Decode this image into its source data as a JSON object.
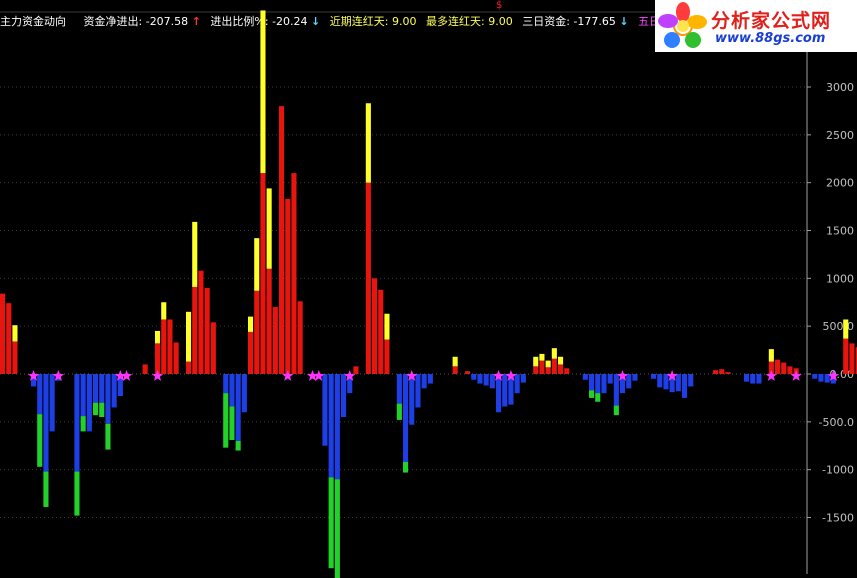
{
  "header": {
    "title": "主力资金动向",
    "items": [
      {
        "label": "资金净进出:",
        "value": "-207.58",
        "arrow": "↑"
      },
      {
        "label": "进出比例%:",
        "value": "-20.24",
        "arrow": "↓"
      },
      {
        "label": "近期连红天:",
        "value": "9.00"
      },
      {
        "label": "最多连红天:",
        "value": "9.00"
      },
      {
        "label": "三日资金:",
        "value": "-177.65",
        "arrow": "↓"
      },
      {
        "label": "五日"
      }
    ],
    "top_marker": "$"
  },
  "logo": {
    "text": "分析家公式网",
    "url": "www.88gs.com"
  },
  "colors": {
    "background": "#000000",
    "positive_bar": "#e8140e",
    "positive_extra": "#ffff2a",
    "negative_bar": "#1e3ee6",
    "negative_extra": "#22d22a",
    "star": "#ff33ff",
    "axis": "#a0a0a0",
    "grid": "#3a3a3a"
  },
  "chart_data": {
    "type": "bar",
    "title": "",
    "ylim": [
      -2000,
      3200
    ],
    "yticks": [
      "3000",
      "2500",
      "2000",
      "1500",
      "1000",
      "500.0",
      "0.00",
      "-500.0",
      "-1000",
      "-1500"
    ],
    "ytick_values": [
      3000,
      2500,
      2000,
      1500,
      1000,
      500,
      0,
      -500,
      -1000,
      -1500
    ],
    "grid": true,
    "legend": "none",
    "series": [
      {
        "values": [
          840,
          740,
          340,
          0,
          0,
          -130,
          -420,
          -1020,
          -600,
          -70,
          0,
          0,
          -1020,
          -440,
          -600,
          -300,
          -300,
          -520,
          -350,
          -230,
          0,
          0,
          0,
          100,
          0,
          320,
          570,
          570,
          330,
          0,
          130,
          910,
          1080,
          900,
          540,
          0,
          -200,
          -340,
          -700,
          -400,
          440,
          870,
          2100,
          1100,
          700,
          2800,
          1830,
          2100,
          760,
          0,
          0,
          0,
          -750,
          -1080,
          -1100,
          -450,
          -200,
          80,
          0,
          2000,
          1000,
          880,
          360,
          0,
          -310,
          -920,
          -530,
          -350,
          -150,
          -100,
          0,
          0,
          0,
          80,
          0,
          30,
          -60,
          -100,
          -120,
          -150,
          -400,
          -340,
          -320,
          -200,
          -90,
          0,
          80,
          140,
          70,
          160,
          100,
          60,
          0,
          0,
          -60,
          -170,
          -200,
          -200,
          -100,
          -330,
          -200,
          -150,
          -70,
          0,
          0,
          -50,
          -140,
          -160,
          -190,
          -180,
          -250,
          -130,
          0,
          0,
          0,
          40,
          50,
          20,
          0,
          0,
          -80,
          -100,
          -100,
          0,
          130,
          150,
          120,
          80,
          60,
          0,
          0,
          -50,
          -80,
          -90,
          -100,
          0,
          370,
          320,
          280,
          240,
          0,
          0,
          0,
          0,
          210,
          250,
          170,
          290,
          210,
          0,
          -90,
          0,
          20,
          0,
          50,
          20,
          30,
          80,
          350,
          210,
          280,
          320,
          240,
          0,
          -300,
          -180
        ]
      },
      {
        "values": [
          0,
          0,
          170,
          0,
          0,
          0,
          -550,
          -370,
          0,
          0,
          0,
          0,
          -460,
          -160,
          0,
          -130,
          -150,
          -270,
          0,
          0,
          0,
          0,
          0,
          0,
          0,
          130,
          180,
          0,
          0,
          0,
          520,
          680,
          0,
          0,
          0,
          0,
          -570,
          -350,
          -100,
          0,
          160,
          550,
          1700,
          840,
          0,
          0,
          0,
          0,
          0,
          0,
          0,
          0,
          0,
          -950,
          -1080,
          0,
          0,
          0,
          0,
          830,
          0,
          0,
          270,
          0,
          -170,
          -110,
          0,
          0,
          0,
          0,
          0,
          0,
          0,
          100,
          0,
          0,
          0,
          0,
          0,
          0,
          0,
          0,
          0,
          0,
          0,
          0,
          100,
          70,
          70,
          110,
          80,
          0,
          0,
          0,
          0,
          -80,
          -90,
          0,
          0,
          -100,
          0,
          0,
          0,
          0,
          0,
          0,
          0,
          0,
          0,
          0,
          0,
          0,
          0,
          0,
          0,
          0,
          0,
          0,
          0,
          0,
          0,
          0,
          0,
          0,
          130,
          0,
          0,
          0,
          0,
          0,
          0,
          0,
          0,
          0,
          0,
          0,
          200,
          0,
          0,
          0,
          0,
          0,
          0,
          0,
          200,
          0,
          100,
          290,
          0,
          0,
          0,
          0,
          0,
          0,
          60,
          70,
          100,
          80,
          230,
          170,
          250,
          280,
          0,
          0,
          0,
          0
        ]
      }
    ],
    "star_indices": [
      5,
      9,
      19,
      20,
      25,
      46,
      50,
      51,
      56,
      66,
      80,
      82,
      100,
      108,
      124,
      128,
      134,
      156,
      158
    ]
  }
}
